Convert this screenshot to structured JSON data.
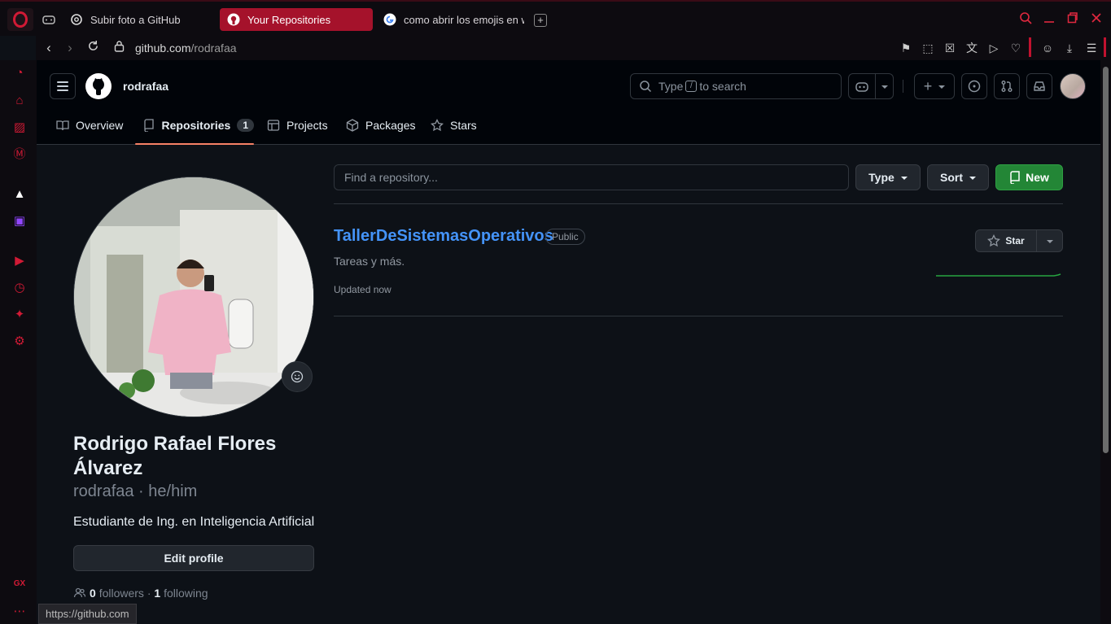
{
  "browser": {
    "tabs": [
      {
        "label": "Subir foto a GitHub",
        "icon": "chatgpt-icon"
      },
      {
        "label": "Your Repositories",
        "icon": "github-icon",
        "active": true
      },
      {
        "label": "como abrir los emojis en w",
        "icon": "google-icon"
      }
    ],
    "url_host": "github.com",
    "url_path": "/rodrafaa",
    "status_url": "https://github.com"
  },
  "header": {
    "username": "rodrafaa",
    "search_prefix": "Type",
    "search_key": "/",
    "search_suffix": "to search"
  },
  "nav": {
    "tabs": [
      {
        "label": "Overview"
      },
      {
        "label": "Repositories",
        "count": "1",
        "selected": true
      },
      {
        "label": "Projects"
      },
      {
        "label": "Packages"
      },
      {
        "label": "Stars"
      }
    ]
  },
  "profile": {
    "full_name": "Rodrigo Rafael Flores Álvarez",
    "login_line": "rodrafaa · he/him",
    "bio": "Estudiante de Ing. en Inteligencia Artificial",
    "edit_label": "Edit profile",
    "followers": "0",
    "followers_label": "followers",
    "separator": "·",
    "following": "1",
    "following_label": "following"
  },
  "repos": {
    "search_placeholder": "Find a repository...",
    "type_label": "Type",
    "sort_label": "Sort",
    "new_label": "New",
    "items": [
      {
        "name": "TallerDeSistemasOperativos",
        "visibility": "Public",
        "description": "Tareas y más.",
        "updated": "Updated now",
        "star_label": "Star"
      }
    ]
  },
  "colors": {
    "accent_red": "#d11a35",
    "link_blue": "#4493f8",
    "new_green": "#238636",
    "tab_underline": "#f78166"
  }
}
